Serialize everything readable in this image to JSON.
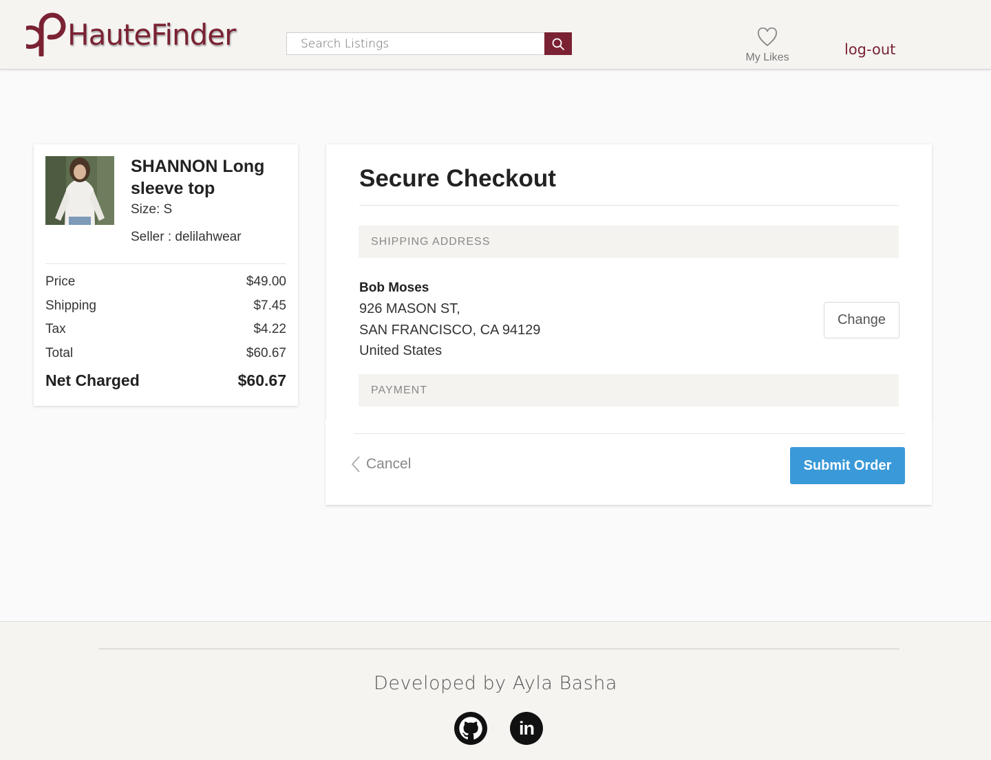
{
  "header": {
    "brand": "HauteFinder",
    "search_placeholder": "Search Listings",
    "my_likes_label": "My Likes",
    "logout_label": "log-out",
    "accent_color": "#7a2233"
  },
  "order_summary": {
    "item_title": "SHANNON Long sleeve top",
    "size": "Size: S",
    "seller": "Seller : delilahwear",
    "costs": [
      {
        "label": "Price",
        "value": "$49.00"
      },
      {
        "label": "Shipping",
        "value": "$7.45"
      },
      {
        "label": "Tax",
        "value": "$4.22"
      },
      {
        "label": "Total",
        "value": "$60.67"
      }
    ],
    "net_label": "Net Charged",
    "net_value": "$60.67"
  },
  "checkout": {
    "title": "Secure Checkout",
    "shipping_header": "SHIPPING ADDRESS",
    "address": {
      "name": "Bob Moses",
      "line1": "926 MASON ST,",
      "line2": "SAN FRANCISCO, CA 94129",
      "line3": "United States"
    },
    "change_label": "Change",
    "payment_header": "PAYMENT",
    "cancel_label": "Cancel",
    "submit_label": "Submit Order",
    "submit_color": "#3a99d8"
  },
  "footer": {
    "credit": "Developed by Ayla Basha",
    "icons": [
      "github-icon",
      "linkedin-icon"
    ]
  }
}
